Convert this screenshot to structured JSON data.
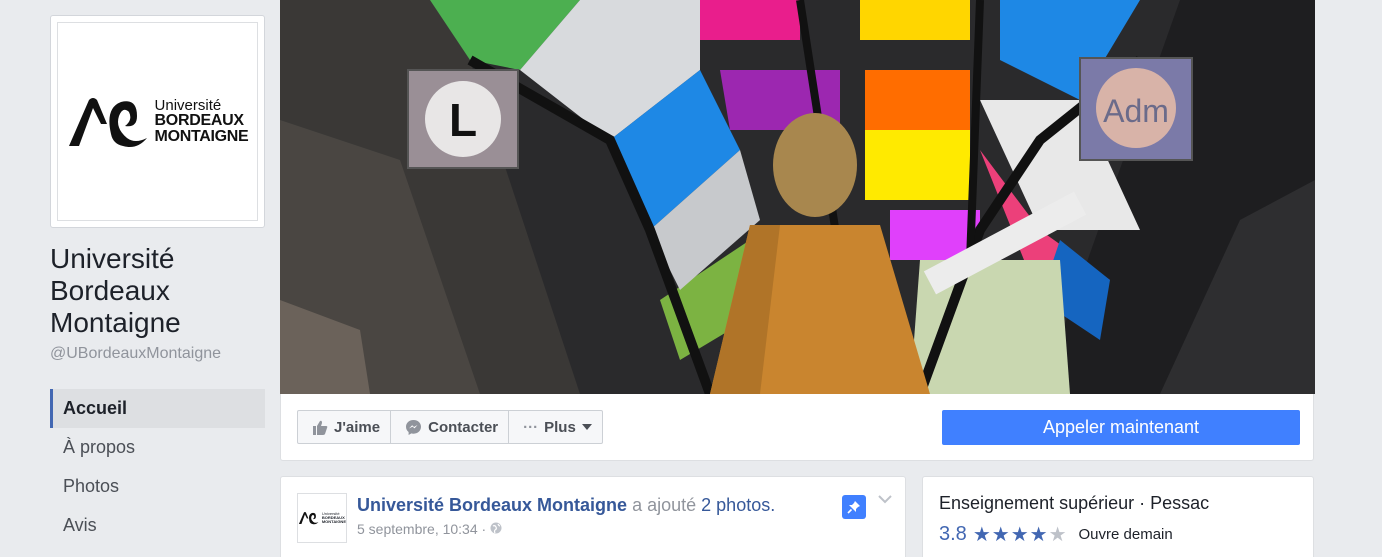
{
  "profile": {
    "logo_line1": "Université",
    "logo_line2": "BORDEAUX",
    "logo_line3": "MONTAIGNE",
    "name": "Université Bordeaux Montaigne",
    "handle": "@UBordeauxMontaigne"
  },
  "nav": {
    "items": [
      {
        "label": "Accueil"
      },
      {
        "label": "À propos"
      },
      {
        "label": "Photos"
      },
      {
        "label": "Avis"
      }
    ]
  },
  "cover": {
    "sign_left": "L",
    "sign_right": "Adm"
  },
  "actions": {
    "like_label": "J'aime",
    "contact_label": "Contacter",
    "more_label": "Plus",
    "call_label": "Appeler maintenant"
  },
  "post": {
    "author": "Université Bordeaux Montaigne",
    "verb": "a ajouté",
    "object": "2 photos.",
    "timestamp": "5 septembre, 10:34 ·"
  },
  "info": {
    "category": "Enseignement supérieur · Pessac",
    "rating": "3.8",
    "stars": 4,
    "status": "Ouvre demain"
  },
  "colors": {
    "accent": "#4080ff",
    "link": "#365899",
    "background": "#e9ebee"
  }
}
